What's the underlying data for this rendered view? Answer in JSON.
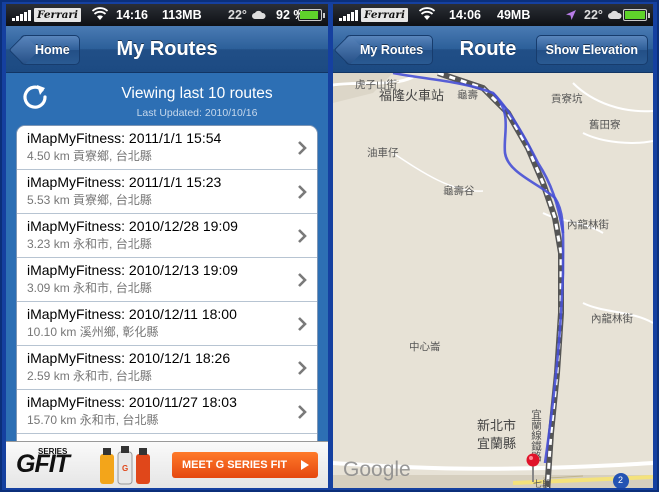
{
  "left_phone": {
    "status": {
      "carrier": "Ferrari",
      "time": "14:16",
      "memory": "113MB",
      "temperature": "22°",
      "battery_pct": "92 %",
      "battery_level": 0.92
    },
    "nav": {
      "back_label": "Home",
      "title": "My Routes"
    },
    "header": {
      "title": "Viewing last 10 routes",
      "last_updated": "Last Updated: 2010/10/16"
    },
    "routes": [
      {
        "name": "iMapMyFitness: 2011/1/1 15:54",
        "detail": "4.50 km 貢寮鄉, 台北縣"
      },
      {
        "name": "iMapMyFitness: 2011/1/1 15:23",
        "detail": "5.53 km 貢寮鄉, 台北縣"
      },
      {
        "name": "iMapMyFitness: 2010/12/28 19:09",
        "detail": "3.23 km 永和市, 台北縣"
      },
      {
        "name": "iMapMyFitness: 2010/12/13 19:09",
        "detail": "3.09 km 永和市, 台北縣"
      },
      {
        "name": "iMapMyFitness: 2010/12/11 18:00",
        "detail": "10.10 km 溪州鄉, 彰化縣"
      },
      {
        "name": "iMapMyFitness: 2010/12/1 18:26",
        "detail": "2.59 km 永和市, 台北縣"
      },
      {
        "name": "iMapMyFitness: 2010/11/27 18:03",
        "detail": "15.70 km 永和市, 台北縣"
      },
      {
        "name": "iMapMyFitness: 2010/10/17 1",
        "detail": ""
      }
    ],
    "ad": {
      "brand": "G",
      "brand_suffix": "FIT",
      "series": "SERIES",
      "cta": "MEET G SERIES FIT"
    }
  },
  "right_phone": {
    "status": {
      "carrier": "Ferrari",
      "time": "14:06",
      "memory": "49MB",
      "temperature": "22°",
      "battery_level": 1.0
    },
    "nav": {
      "back_label": "My Routes",
      "title": "Route",
      "action_label": "Show Elevation"
    },
    "map": {
      "labels": {
        "huzishan": "虎子山街",
        "fulong_station": "福隆火車站",
        "guishou": "龜壽",
        "gongliao_fulong": "貢寮坑",
        "jiutian": "舊田寮",
        "youche": "油車仔",
        "guishougu": "龜壽谷",
        "neilongjie": "內龍林街",
        "neilonglin": "內龍林街",
        "zhongxin": "中心崙",
        "yilan_railway": "宜蘭線鐵路",
        "xinbei": "新北市",
        "yilan_county": "宜蘭縣",
        "road_2": "2",
        "lin": "七段"
      },
      "attribution": "Google"
    }
  }
}
